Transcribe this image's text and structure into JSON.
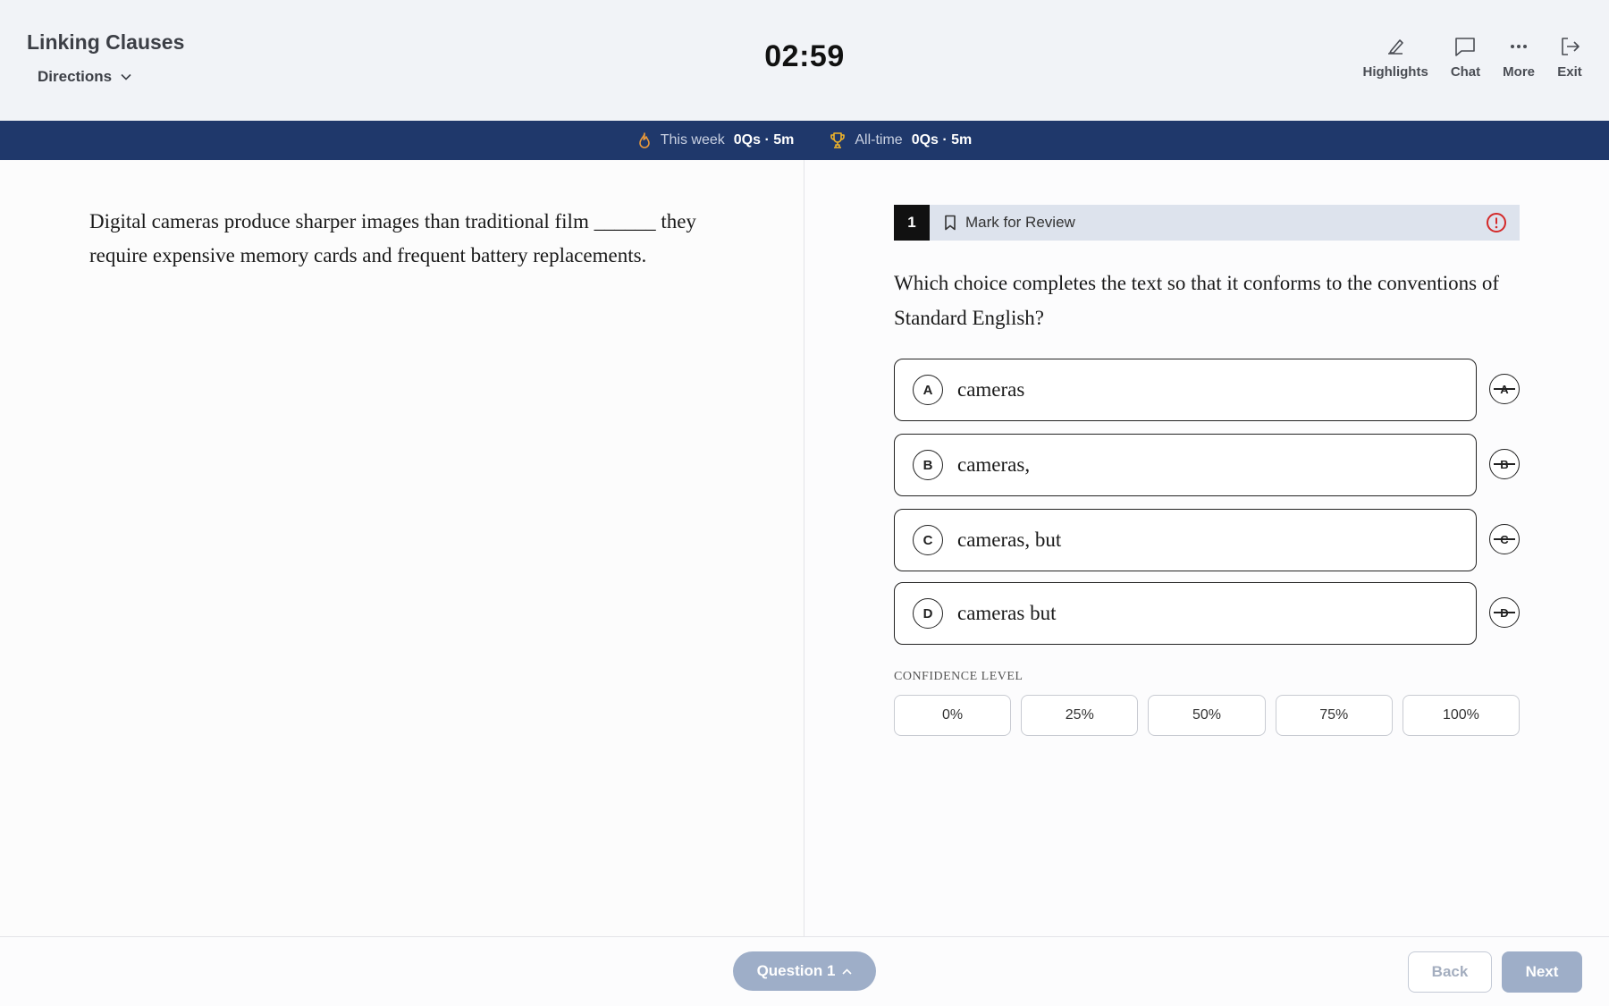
{
  "header": {
    "section_title": "Linking Clauses",
    "directions_label": "Directions",
    "timer": "02:59",
    "tools": [
      {
        "label": "Highlights",
        "icon": "highlighter-icon"
      },
      {
        "label": "Chat",
        "icon": "chat-icon"
      },
      {
        "label": "More",
        "icon": "more-icon"
      },
      {
        "label": "Exit",
        "icon": "exit-icon"
      }
    ]
  },
  "stats": {
    "week_label": "This week",
    "week_value": "0Qs · 5m",
    "alltime_label": "All-time",
    "alltime_value": "0Qs · 5m"
  },
  "passage": {
    "before_blank": "Digital cameras produce sharper images than traditional film",
    "blank": "______",
    "after_blank": "they require expensive memory cards and frequent battery replacements."
  },
  "question": {
    "number": "1",
    "mark_label": "Mark for Review",
    "prompt": "Which choice completes the text so that it conforms to the conventions of Standard English?",
    "choices": [
      {
        "letter": "A",
        "text": "cameras"
      },
      {
        "letter": "B",
        "text": "cameras,"
      },
      {
        "letter": "C",
        "text": "cameras, but"
      },
      {
        "letter": "D",
        "text": "cameras but"
      }
    ]
  },
  "confidence": {
    "label": "CONFIDENCE LEVEL",
    "options": [
      "0%",
      "25%",
      "50%",
      "75%",
      "100%"
    ]
  },
  "footer": {
    "question_nav": "Question 1",
    "back_label": "Back",
    "next_label": "Next"
  },
  "colors": {
    "stats_bar": "#1f386b",
    "flame": "#e8983a",
    "trophy": "#f0b429",
    "alert": "#d42a2a",
    "nav_button": "#9eaec8"
  }
}
